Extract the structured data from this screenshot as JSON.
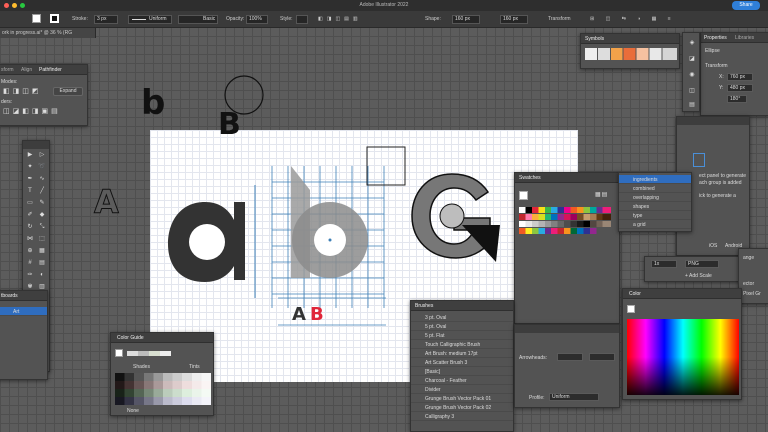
{
  "app": {
    "title": "Adobe Illustrator 2022",
    "share_label": "Share"
  },
  "control_bar": {
    "stroke_label": "Stroke:",
    "stroke_value": "3 px",
    "stroke_profile": "Uniform",
    "brush_value": "Basic",
    "opacity_label": "Opacity:",
    "opacity_value": "100%",
    "style_label": "Style:",
    "shape_label": "Shape:",
    "width_value": "160 px",
    "height_value": "160 px",
    "transform_label": "Transform"
  },
  "document_tab": {
    "label": "ork in progress.ai* @ 36 % (RG"
  },
  "pathfinder_panel": {
    "tabs": [
      "sform",
      "Align",
      "Pathfinder"
    ],
    "shape_modes_label": "Modes:",
    "pathfinders_label": "ders:",
    "expand_label": "Expand"
  },
  "artboards_panel": {
    "tab_label": "tboards",
    "row_label": "Art"
  },
  "color_guide_panel": {
    "title": "Color Guide",
    "shades_label": "Shades",
    "tints_label": "Tints",
    "none_label": "None"
  },
  "symbols_panel": {
    "title": "Symbols"
  },
  "properties_panel": {
    "tabs": [
      "Properties",
      "Libraries"
    ],
    "object_type": "Ellipse",
    "transform_label": "Transform",
    "x_label": "X:",
    "x_value": "760 px",
    "y_label": "Y:",
    "y_value": "480 px",
    "angle_value": "180°"
  },
  "swatches_panel": {
    "title": "Swatches"
  },
  "layers_panel": {
    "items": [
      "ingredients",
      "combined",
      "overlapping",
      "shapes",
      "type",
      "a grid"
    ]
  },
  "asset_export_panel": {
    "hint_lines": [
      "ect panel to generate",
      "ach group is added",
      "ick to generate a"
    ],
    "platform_ios": "iOS",
    "platform_android": "Android",
    "scale_value": "1x",
    "format_value": "PNG",
    "add_scale_label": "+ Add Scale",
    "side_labels": [
      "ange",
      "ector",
      "Pixel Gr"
    ]
  },
  "color_panel": {
    "title": "Color"
  },
  "brushes_panel": {
    "title": "Brushes",
    "items": [
      "3 pt. Oval",
      "5 pt. Oval",
      "5 pt. Flat",
      "Touch Calligraphic Brush",
      "Art Brush: medium 17pt",
      "Art Scatter Brush 3",
      "[Basic]",
      "Charcoal - Feather",
      "Divider",
      "Grunge Brush Vector Pack 01",
      "Grunge Brush Vector Pack 02",
      "Calligraphy 3"
    ]
  },
  "stroke_panel": {
    "arrowheads_label": "Arrowheads:",
    "profile_label": "Profile:",
    "profile_value": "Uniform"
  },
  "canvas_text": {
    "letter_b_small": "b",
    "letter_b_capital": "B",
    "letter_a_outline": "A",
    "letter_a": "A",
    "letter_b_red": "B"
  },
  "colors": {
    "accent_blue": "#2f7fd8",
    "brand_red": "#e0263a",
    "letter_dark": "#333333",
    "guide_blue": "#3d7fb6"
  }
}
